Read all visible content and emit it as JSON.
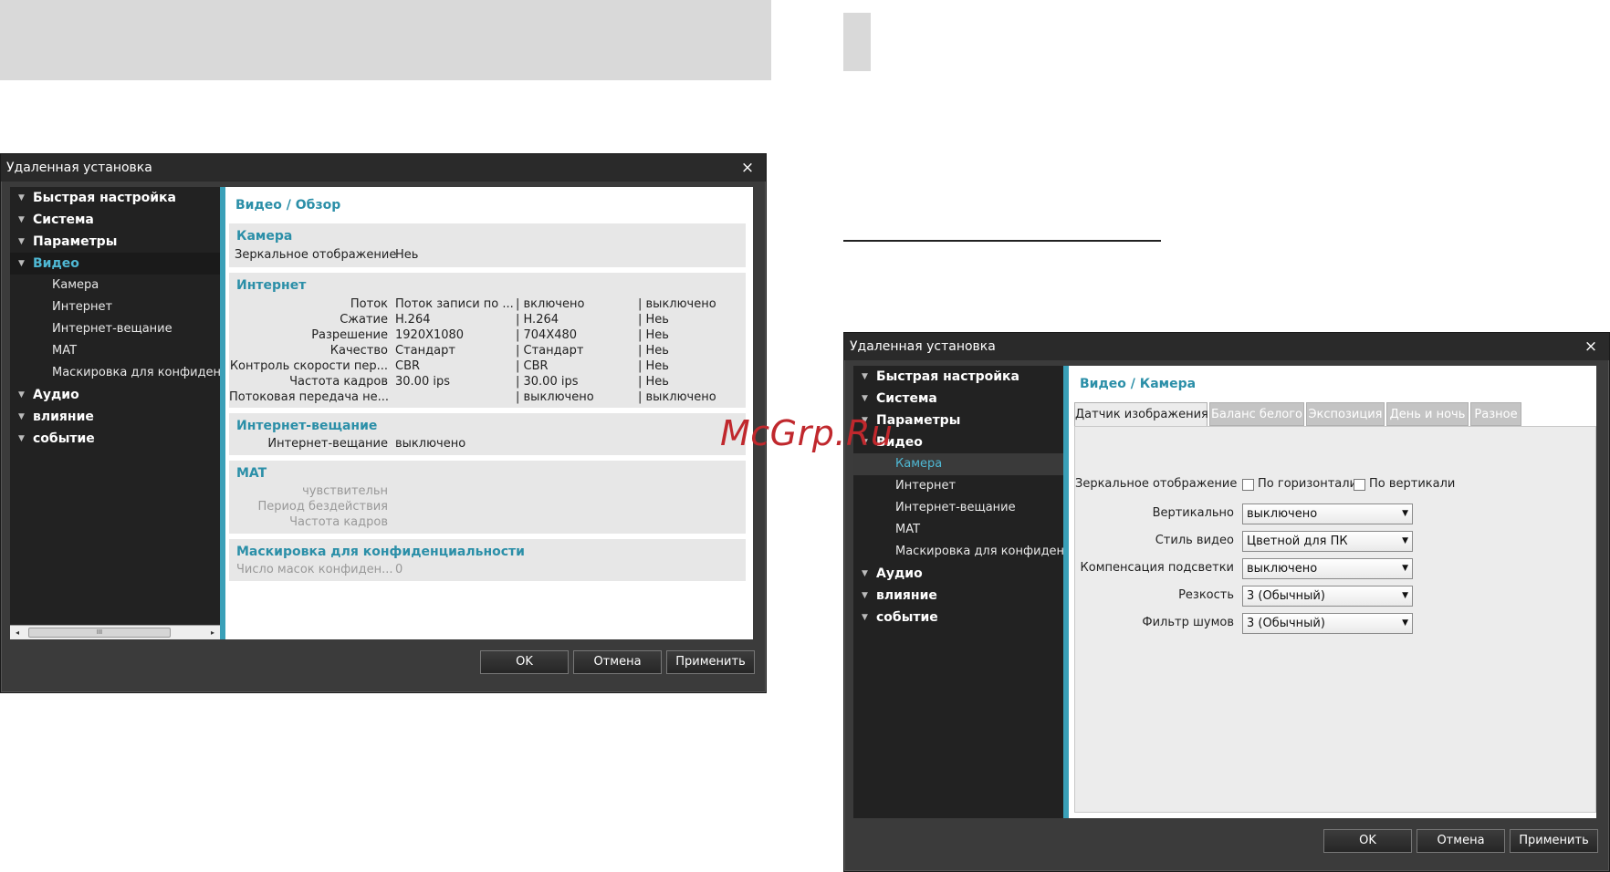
{
  "watermark": "McGrp.Ru",
  "dialog1": {
    "title": "Удаленная установка",
    "close": "×",
    "tree": [
      {
        "label": "Быстрая настройка",
        "level": 1
      },
      {
        "label": "Система",
        "level": 1
      },
      {
        "label": "Параметры",
        "level": 1
      },
      {
        "label": "Видео",
        "level": 1,
        "selected": true
      },
      {
        "label": "Камера",
        "level": 2
      },
      {
        "label": "Интернет",
        "level": 2
      },
      {
        "label": "Интернет-вещание",
        "level": 2
      },
      {
        "label": "MAT",
        "level": 2
      },
      {
        "label": "Маскировка для конфиденци",
        "level": 2
      },
      {
        "label": "Аудио",
        "level": 1
      },
      {
        "label": "влияние",
        "level": 1
      },
      {
        "label": "событие",
        "level": 1
      }
    ],
    "scroll": {
      "left": "◂",
      "right": "▸",
      "grip": "III"
    },
    "content_title": "Видео / Обзор",
    "camera": {
      "title": "Камера",
      "label": "Зеркальное отображение",
      "value": "Нeь"
    },
    "internet": {
      "title": "Интернет",
      "rows": [
        {
          "label": "Поток",
          "c1": "Поток записи по ...",
          "c2": "| включено",
          "c3": "| выключено"
        },
        {
          "label": "Сжатие",
          "c1": "H.264",
          "c2": "| H.264",
          "c3": "| Нeь"
        },
        {
          "label": "Разрешение",
          "c1": "1920X1080",
          "c2": "| 704X480",
          "c3": "| Нeь"
        },
        {
          "label": "Качество",
          "c1": "Стандарт",
          "c2": "| Стандарт",
          "c3": "| Нeь"
        },
        {
          "label": "Контроль скорости пер...",
          "c1": "CBR",
          "c2": "| CBR",
          "c3": "| Нeь"
        },
        {
          "label": "Частота кадров",
          "c1": "30.00 ips",
          "c2": "| 30.00 ips",
          "c3": "| Нeь"
        },
        {
          "label": "Потоковая передача не...",
          "c1": "",
          "c2": "| выключено",
          "c3": "| выключено"
        }
      ]
    },
    "broadcast": {
      "title": "Интернет-вещание",
      "label": "Интернет-вещание",
      "value": "выключено"
    },
    "mat": {
      "title": "MAT",
      "rows": [
        "чувствительн",
        "Период бездействия",
        "Частота кадров"
      ]
    },
    "privacy": {
      "title": "Маскировка для конфиденциальности",
      "label": "Число масок конфиден...",
      "value": "0"
    },
    "buttons": {
      "ok": "OK",
      "cancel": "Отмена",
      "apply": "Применить"
    }
  },
  "dialog2": {
    "title": "Удаленная установка",
    "close": "×",
    "tree": [
      {
        "label": "Быстрая настройка",
        "level": 1
      },
      {
        "label": "Система",
        "level": 1
      },
      {
        "label": "Параметры",
        "level": 1
      },
      {
        "label": "Видео",
        "level": 1
      },
      {
        "label": "Камера",
        "level": 2,
        "selected": true
      },
      {
        "label": "Интернет",
        "level": 2
      },
      {
        "label": "Интернет-вещание",
        "level": 2
      },
      {
        "label": "MAT",
        "level": 2
      },
      {
        "label": "Маскировка для конфиденци",
        "level": 2
      },
      {
        "label": "Аудио",
        "level": 1
      },
      {
        "label": "влияние",
        "level": 1
      },
      {
        "label": "событие",
        "level": 1
      }
    ],
    "content_title": "Видео / Камера",
    "tabs": [
      "Датчик изображения",
      "Баланс белого",
      "Экспозиция",
      "День и ночь",
      "Разное"
    ],
    "active_tab": "Датчик изображения",
    "mirror": {
      "label": "Зеркальное отображение",
      "horizontal": "По горизонтали",
      "vertical": "По вертикали",
      "horizontal_checked": false,
      "vertical_checked": false
    },
    "fields": [
      {
        "label": "Вертикально",
        "value": "выключено"
      },
      {
        "label": "Стиль видео",
        "value": "Цветной для ПК"
      },
      {
        "label": "Компенсация подсветки",
        "value": "выключено"
      },
      {
        "label": "Резкость",
        "value": "3 (Обычный)"
      },
      {
        "label": "Фильтр шумов",
        "value": "3 (Обычный)"
      }
    ],
    "buttons": {
      "ok": "OK",
      "cancel": "Отмена",
      "apply": "Применить"
    }
  }
}
